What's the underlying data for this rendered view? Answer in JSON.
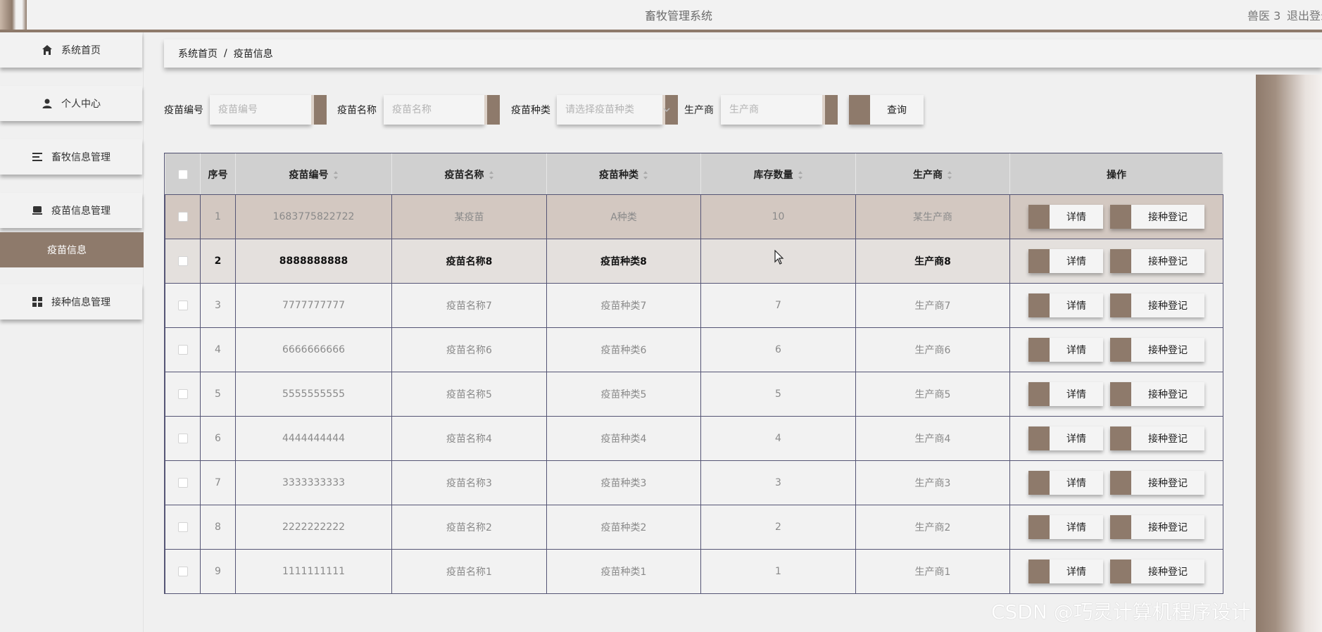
{
  "app": {
    "title": "畜牧管理系统",
    "user": "兽医 3",
    "logout": "退出登录"
  },
  "sidebar": {
    "items": [
      {
        "label": "系统首页",
        "icon": "home-icon"
      },
      {
        "label": "个人中心",
        "icon": "user-icon"
      },
      {
        "label": "畜牧信息管理",
        "icon": "list-icon"
      },
      {
        "label": "疫苗信息管理",
        "icon": "box-icon"
      },
      {
        "label": "接种信息管理",
        "icon": "grid-icon"
      }
    ],
    "active_sub": "疫苗信息"
  },
  "breadcrumb": {
    "home": "系统首页",
    "separator": "/",
    "current": "疫苗信息"
  },
  "search": {
    "code_label": "疫苗编号",
    "code_placeholder": "疫苗编号",
    "name_label": "疫苗名称",
    "name_placeholder": "疫苗名称",
    "type_label": "疫苗种类",
    "type_placeholder": "请选择疫苗种类",
    "maker_label": "生产商",
    "maker_placeholder": "生产商",
    "query_button": "查询"
  },
  "table": {
    "headers": {
      "index": "序号",
      "code": "疫苗编号",
      "name": "疫苗名称",
      "type": "疫苗种类",
      "stock": "库存数量",
      "maker": "生产商",
      "ops": "操作"
    },
    "detail_label": "详情",
    "register_label": "接种登记",
    "rows": [
      {
        "index": "1",
        "code": "1683775822722",
        "name": "某疫苗",
        "type": "A种类",
        "stock": "10",
        "maker": "某生产商"
      },
      {
        "index": "2",
        "code": "8888888888",
        "name": "疫苗名称8",
        "type": "疫苗种类8",
        "stock": "",
        "maker": "生产商8"
      },
      {
        "index": "3",
        "code": "7777777777",
        "name": "疫苗名称7",
        "type": "疫苗种类7",
        "stock": "7",
        "maker": "生产商7"
      },
      {
        "index": "4",
        "code": "6666666666",
        "name": "疫苗名称6",
        "type": "疫苗种类6",
        "stock": "6",
        "maker": "生产商6"
      },
      {
        "index": "5",
        "code": "5555555555",
        "name": "疫苗名称5",
        "type": "疫苗种类5",
        "stock": "5",
        "maker": "生产商5"
      },
      {
        "index": "6",
        "code": "4444444444",
        "name": "疫苗名称4",
        "type": "疫苗种类4",
        "stock": "4",
        "maker": "生产商4"
      },
      {
        "index": "7",
        "code": "3333333333",
        "name": "疫苗名称3",
        "type": "疫苗种类3",
        "stock": "3",
        "maker": "生产商3"
      },
      {
        "index": "8",
        "code": "2222222222",
        "name": "疫苗名称2",
        "type": "疫苗种类2",
        "stock": "2",
        "maker": "生产商2"
      },
      {
        "index": "9",
        "code": "1111111111",
        "name": "疫苗名称1",
        "type": "疫苗种类1",
        "stock": "1",
        "maker": "生产商1"
      }
    ]
  },
  "watermark": "CSDN @巧灵计算机程序设计",
  "colors": {
    "accent": "#8e7a6b",
    "header_bg": "#d0d0d0",
    "row_selected": "#d3c8c1",
    "row_hover": "#e4e0dd"
  }
}
